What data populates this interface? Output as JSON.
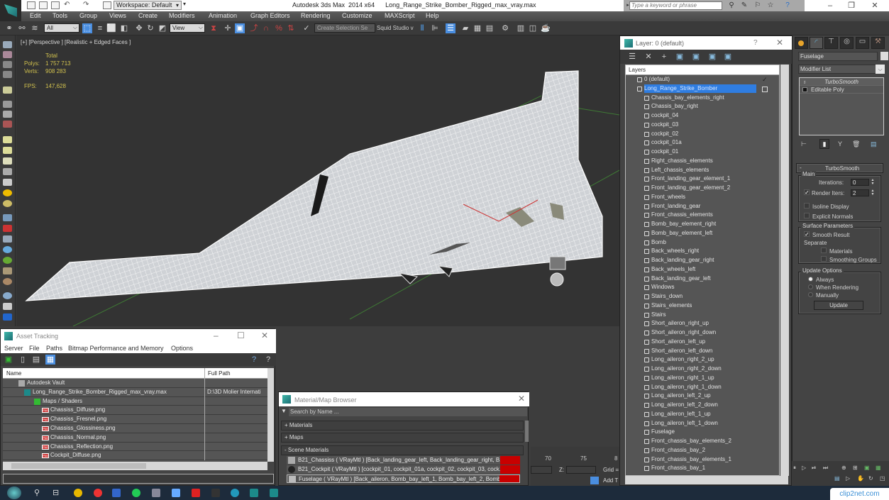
{
  "app": {
    "window_title": "Autodesk 3ds Max  2014 x64      Long_Range_Strike_Bomber_Rigged_max_vray.max",
    "workspace": "Workspace: Default",
    "search_placeholder": "Type a keyword or phrase",
    "window_controls": [
      "minimize",
      "restore",
      "close"
    ]
  },
  "menu": [
    "Edit",
    "Tools",
    "Group",
    "Views",
    "Create",
    "Modifiers",
    "Animation",
    "Graph Editors",
    "Rendering",
    "Customize",
    "MAXScript",
    "Help"
  ],
  "toolbar": {
    "selection_filter": "All",
    "reference_coord": "View",
    "named_selection_placeholder": "Create Selection Se",
    "squid_label": "Squid Studio v"
  },
  "viewport": {
    "label": "[+] [Perspective ] [Realistic + Edged Faces ]",
    "stats": {
      "header": "Total",
      "polys_label": "Polys:",
      "polys": "1 757 713",
      "verts_label": "Verts:",
      "verts": "908 283",
      "fps_label": "FPS:",
      "fps": "147,628"
    }
  },
  "layer_explorer": {
    "title": "Layer: 0 (default)",
    "help": "?",
    "column_header": "Layers",
    "default_layer": "0 (default)",
    "active_layer": "Long_Range_Strike_Bomber",
    "objects": [
      "Chassis_bay_elements_right",
      "Chassis_bay_right",
      "cockpit_04",
      "cockpit_03",
      "cockpit_02",
      "cockpit_01a",
      "cockpit_01",
      "Right_chassis_elements",
      "Left_chassis_elements",
      "Front_landing_gear_element_1",
      "Front_landing_gear_element_2",
      "Front_wheels",
      "Front_landing_gear",
      "Front_chassis_elements",
      "Bomb_bay_element_right",
      "Bomb_bay_element_left",
      "Bomb",
      "Back_wheels_right",
      "Back_landing_gear_right",
      "Back_wheels_left",
      "Back_landing_gear_left",
      "Windows",
      "Stairs_down",
      "Stairs_elements",
      "Stairs",
      "Short_aileron_right_up",
      "Short_aileron_right_down",
      "Short_aileron_left_up",
      "Short_aileron_left_down",
      "Long_aileron_right_2_up",
      "Long_aileron_right_2_down",
      "Long_aileron_right_1_up",
      "Long_aileron_right_1_down",
      "Long_aileron_left_2_up",
      "Long_aileron_left_2_down",
      "Long_aileron_left_1_up",
      "Long_aileron_left_1_down",
      "Fuselage",
      "Front_chassis_bay_elements_2",
      "Front_chassis_bay_2",
      "Front_chassis_bay_elements_1",
      "Front_chassis_bay_1"
    ]
  },
  "command_panel": {
    "object_name": "Fuselage",
    "modifier_list": "Modifier List",
    "stack": [
      "TurboSmooth",
      "Editable Poly"
    ],
    "rollout_title": "TurboSmooth",
    "main_group": "Main",
    "iterations_label": "Iterations:",
    "iterations": "0",
    "render_iters_label": "Render Iters:",
    "render_iters": "2",
    "render_iters_checked": true,
    "isoline_display": "Isoline Display",
    "explicit_normals": "Explicit Normals",
    "surface_group": "Surface Parameters",
    "smooth_result": "Smooth Result",
    "separate_label": "Separate",
    "materials": "Materials",
    "smoothing_groups": "Smoothing Groups",
    "update_group": "Update Options",
    "update_options": [
      "Always",
      "When Rendering",
      "Manually"
    ],
    "update_selected": "Always",
    "update_button": "Update"
  },
  "asset_tracking": {
    "title": "Asset Tracking",
    "menu": [
      "Server",
      "File",
      "Paths",
      "Bitmap Performance and Memory",
      "Options"
    ],
    "columns": [
      "Name",
      "Full Path"
    ],
    "rows": [
      {
        "name": "Autodesk Vault",
        "path": "",
        "level": 1,
        "icon": "vault"
      },
      {
        "name": "Long_Range_Strike_Bomber_Rigged_max_vray.max",
        "path": "D:\\3D Molier Internati",
        "level": 2,
        "icon": "max"
      },
      {
        "name": "Maps / Shaders",
        "path": "",
        "level": 3,
        "icon": "maps"
      },
      {
        "name": "Chassiss_Diffuse.png",
        "path": "",
        "level": 4,
        "icon": "png"
      },
      {
        "name": "Chassiss_Fresnel.png",
        "path": "",
        "level": 4,
        "icon": "png"
      },
      {
        "name": "Chassiss_Glossiness.png",
        "path": "",
        "level": 4,
        "icon": "png"
      },
      {
        "name": "Chassiss_Normal.png",
        "path": "",
        "level": 4,
        "icon": "png"
      },
      {
        "name": "Chassiss_Reflection.png",
        "path": "",
        "level": 4,
        "icon": "png"
      },
      {
        "name": "Cockpit_Diffuse.png",
        "path": "",
        "level": 4,
        "icon": "png"
      }
    ]
  },
  "material_browser": {
    "title": "Material/Map Browser",
    "search_placeholder": "Search by Name ...",
    "groups": [
      "+ Materials",
      "+ Maps",
      "- Scene Materials"
    ],
    "scene_materials": [
      "B21_Chassiss  ( VRayMtl ) [Back_landing_gear_left, Back_landing_gear_right, B...",
      "B21_Cockpit  ( VRayMtl ) [cockpit_01, cockpit_01a, cockpit_02, cockpit_03, cock...",
      "Fuselage  ( VRayMtl ) [Back_aileron, Bomb_bay_left_1, Bomb_bay_left_2, Bomb..."
    ]
  },
  "timeline": {
    "ticks": [
      "70",
      "75",
      "8"
    ],
    "z_label": "Z:",
    "grid_label": "Grid =",
    "add_time_tag": "Add T"
  },
  "watermark": "clip2net.com"
}
